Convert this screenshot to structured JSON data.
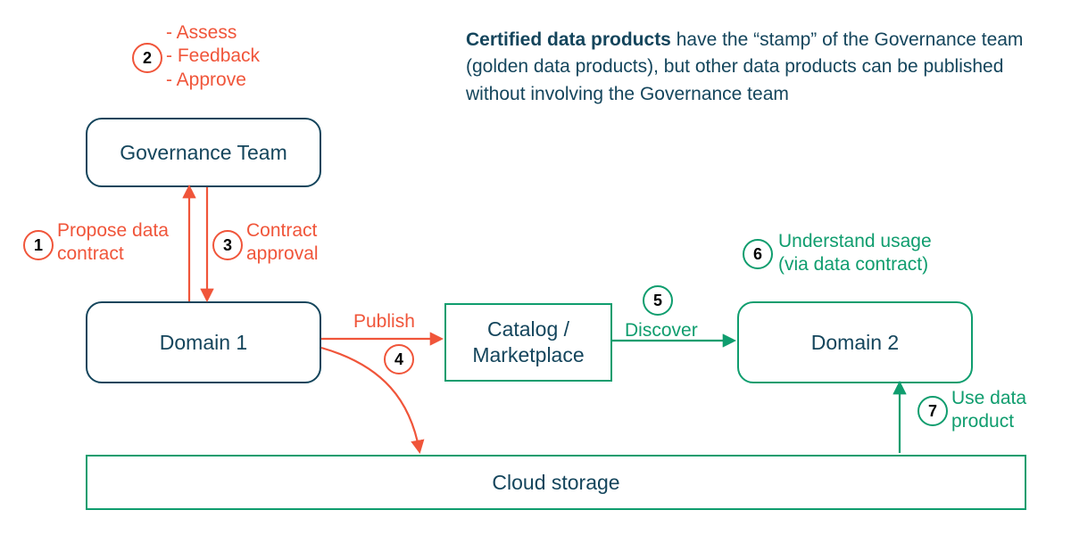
{
  "blurb_bold": "Certified data products",
  "blurb_rest": " have the “stamp” of the Governance team (golden data products), but other data products can be published without involving the Governance team",
  "box_governance": "Governance Team",
  "box_domain1": "Domain 1",
  "box_catalog_l1": "Catalog /",
  "box_catalog_l2": "Marketplace",
  "box_domain2": "Domain 2",
  "box_cloud": "Cloud storage",
  "step1_num": "1",
  "step1_l1": "Propose data",
  "step1_l2": "contract",
  "step2_num": "2",
  "step2_l1": "- Assess",
  "step2_l2": "- Feedback",
  "step2_l3": "- Approve",
  "step3_num": "3",
  "step3_l1": "Contract",
  "step3_l2": "approval",
  "step4_num": "4",
  "step4_label": "Publish",
  "step5_num": "5",
  "step5_label": "Discover",
  "step6_num": "6",
  "step6_l1": "Understand usage",
  "step6_l2": "(via data contract)",
  "step7_num": "7",
  "step7_l1": "Use data",
  "step7_l2": "product"
}
